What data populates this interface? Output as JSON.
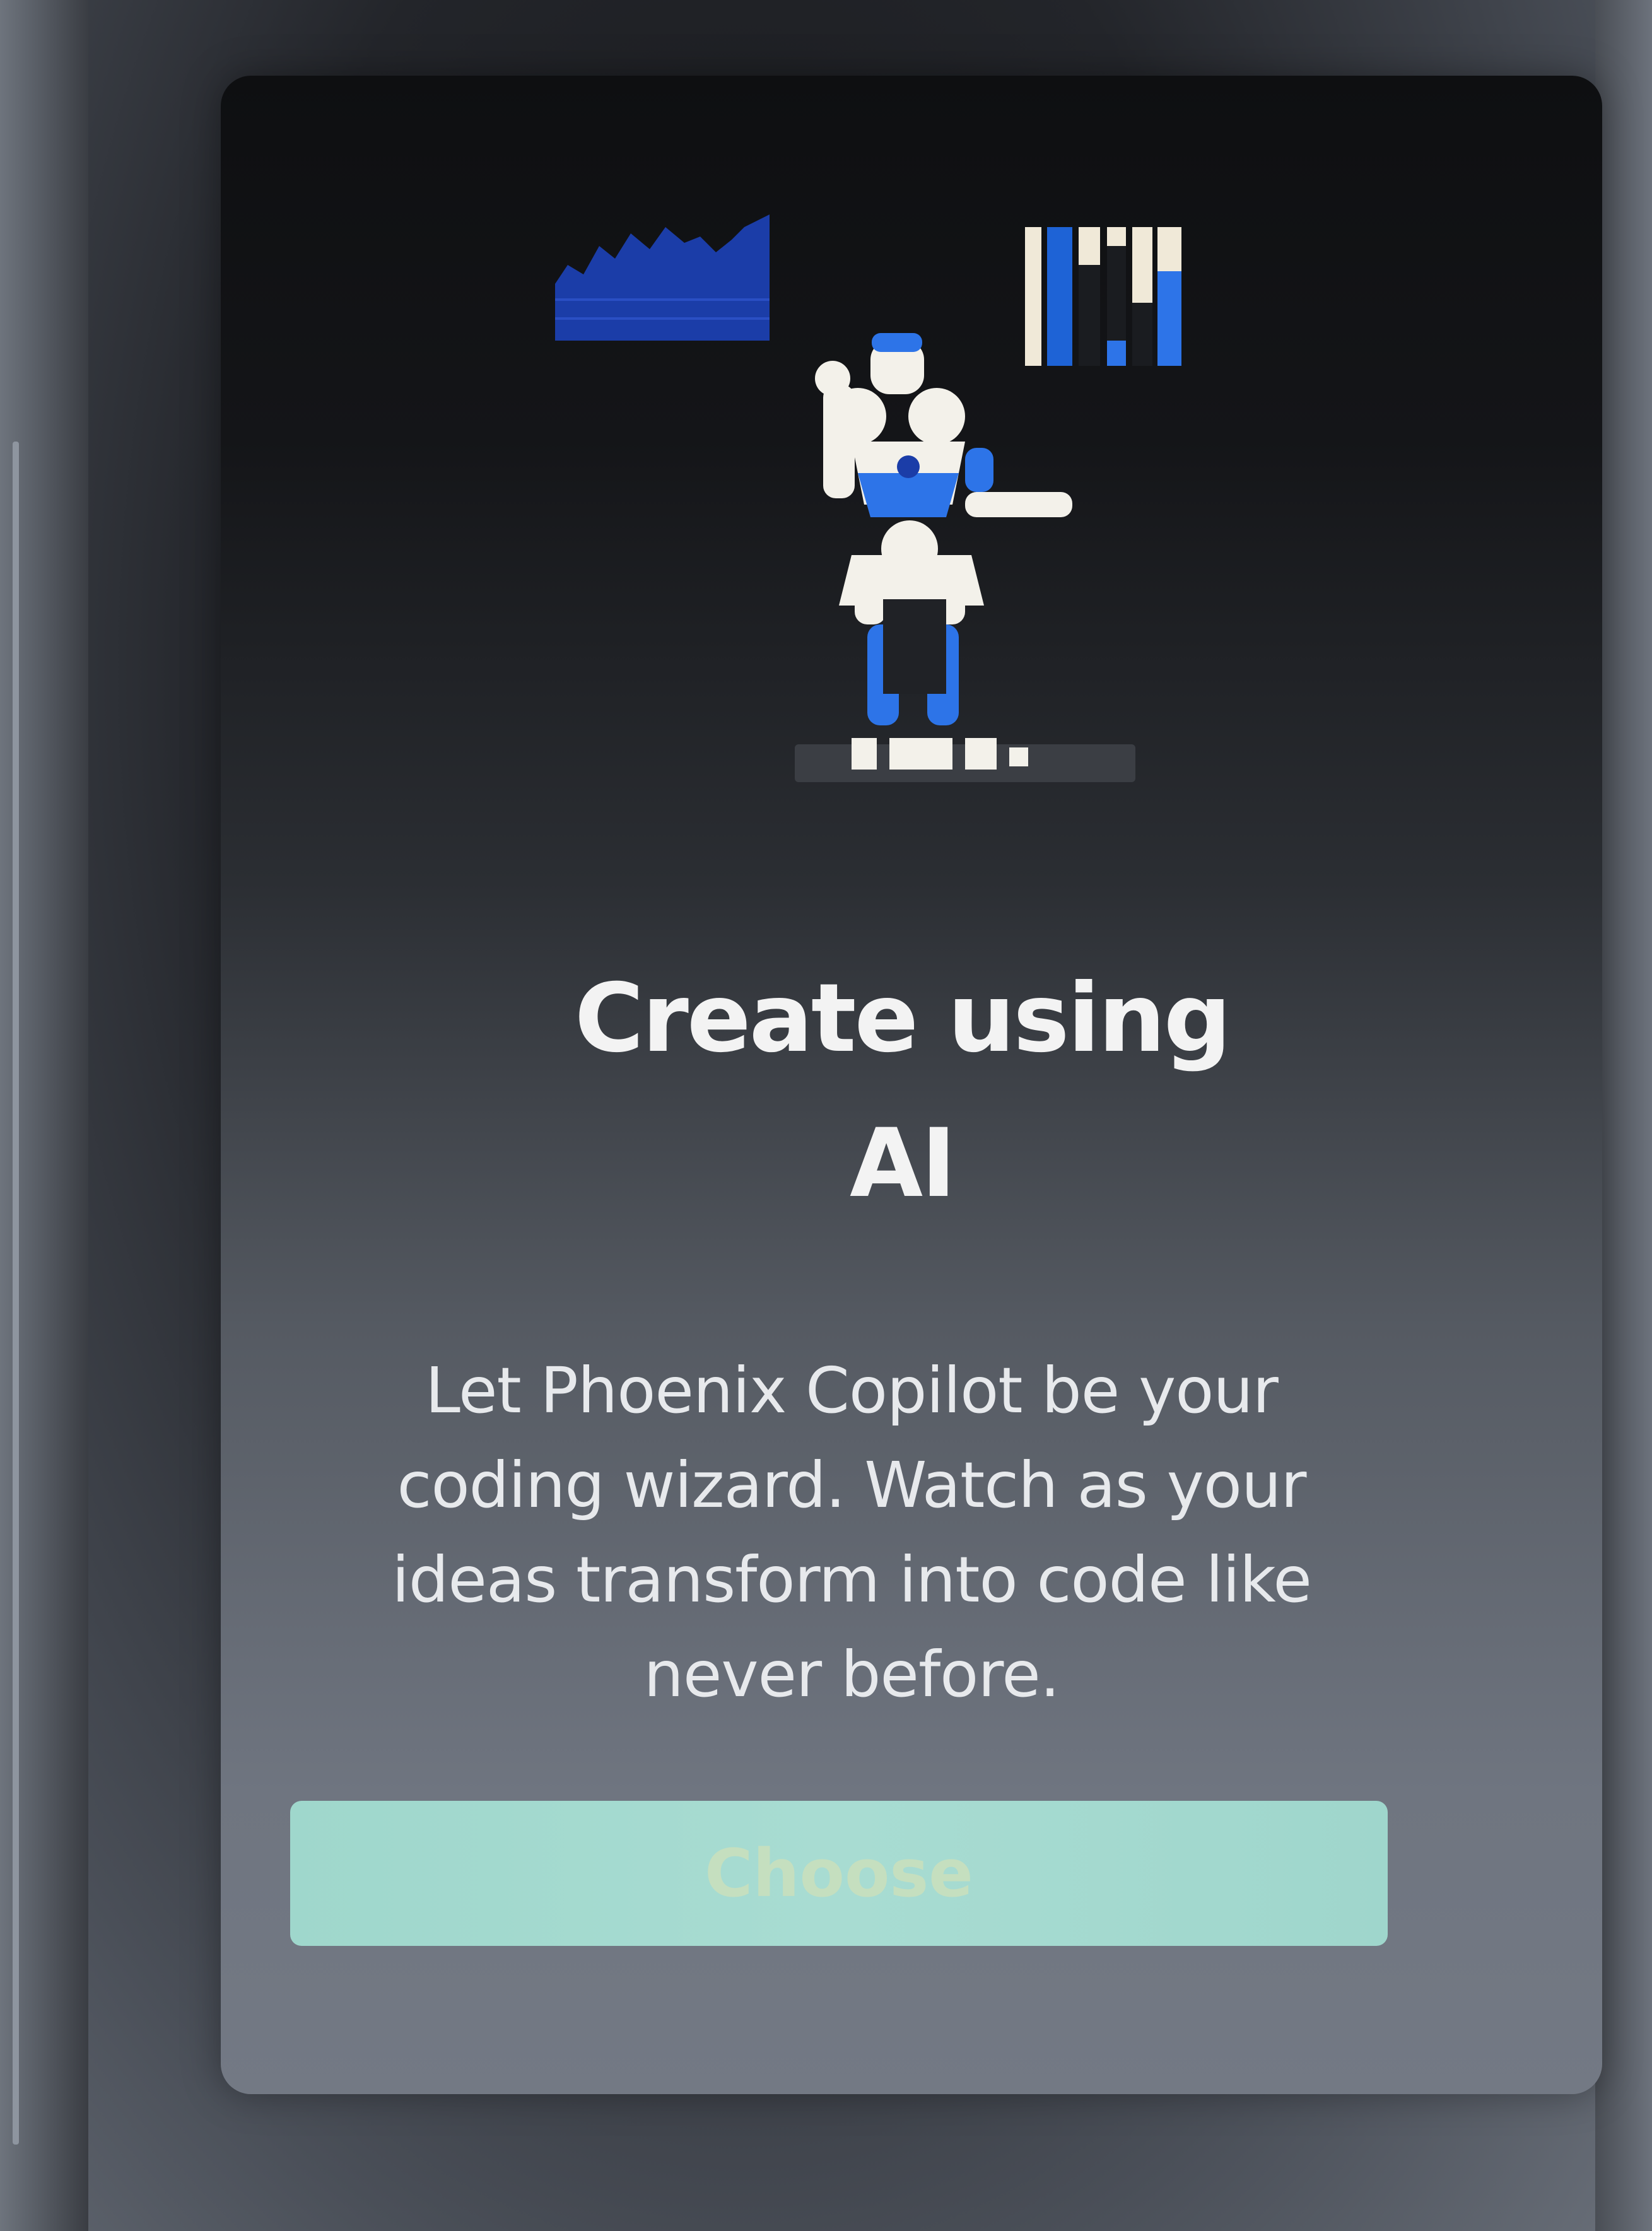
{
  "card": {
    "title_line1": "Create using",
    "title_line2": "AI",
    "description": "Let Phoenix Copilot be your coding wizard. Watch as your ideas transform into code like never before.",
    "button_label": "Choose"
  },
  "colors": {
    "card_background_top": "#0e0f11",
    "card_background_bottom": "#737984",
    "button_background": "#a8dcd2",
    "illustration_blue": "#2d74e8",
    "illustration_dark_blue": "#1b3da8",
    "title_text": "#f3f3f3"
  },
  "icons": {
    "illustration": "robot-analytics-illustration"
  }
}
